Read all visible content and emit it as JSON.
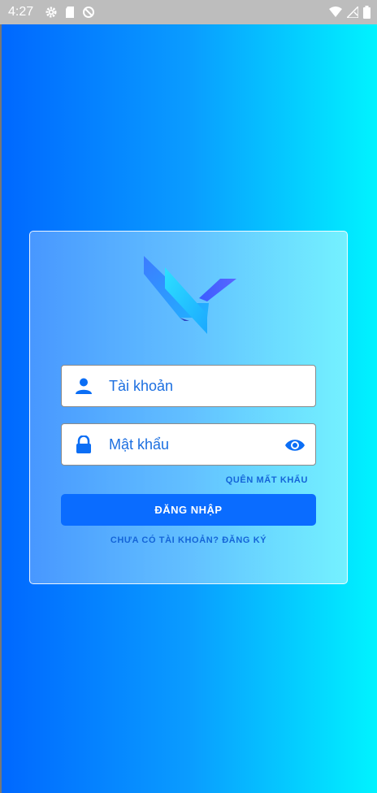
{
  "status_bar": {
    "time": "4:27",
    "icons_left": [
      "gear-icon",
      "sd-card-icon",
      "do-not-disturb-icon"
    ],
    "icons_right": [
      "wifi-icon",
      "signal-icon",
      "battery-icon"
    ]
  },
  "login": {
    "logo": "app-logo",
    "username_placeholder": "Tài khoản",
    "password_placeholder": "Mật khẩu",
    "forgot_label": "QUÊN MẤT KHẨU",
    "login_label": "ĐĂNG NHẬP",
    "register_label": "CHƯA CÓ TÀI KHOẢN? ĐĂNG KÝ"
  },
  "colors": {
    "gradient_start": "#0068ff",
    "gradient_end": "#00f3ff",
    "button": "#0a6cff",
    "link": "#1565d8",
    "input_text": "#1c6fe0"
  }
}
